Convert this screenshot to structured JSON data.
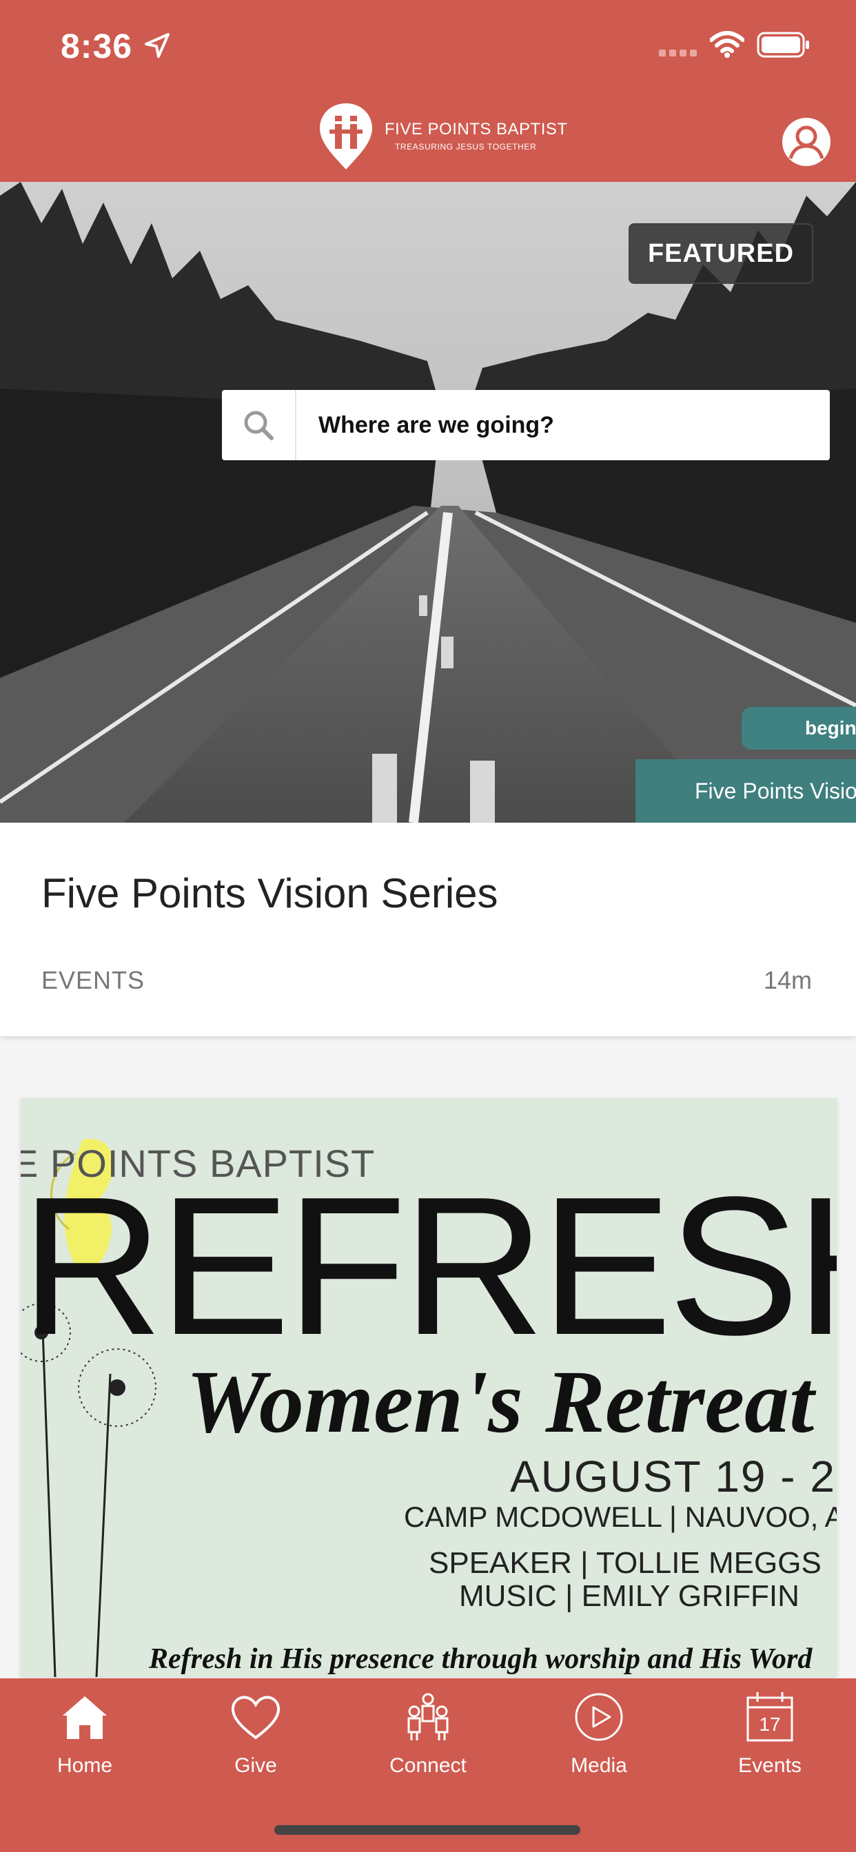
{
  "status_bar": {
    "time": "8:36"
  },
  "header": {
    "brand_name": "FIVE POINTS BAPTIST",
    "brand_tagline": "TREASURING JESUS TOGETHER"
  },
  "featured": {
    "badge": "FEATURED",
    "search_placeholder": "Where are we going?",
    "begin_pill": "begin",
    "strip_text": "Five Points Visio"
  },
  "card": {
    "title": "Five Points Vision Series",
    "category": "EVENTS",
    "age": "14m"
  },
  "retreat_card": {
    "church": "E POINTS BAPTIST",
    "headline": "REFRESH",
    "subheadline": "Women's Retreat",
    "date": "AUGUST 19 - 2",
    "location": "CAMP MCDOWELL  |  NAUVOO, AL",
    "speaker": "SPEAKER  | TOLLIE MEGGS",
    "music": "MUSIC    | EMILY GRIFFIN",
    "tagline": "Refresh in His presence through worship and His Word"
  },
  "tabs": [
    {
      "label": "Home",
      "icon": "home-icon"
    },
    {
      "label": "Give",
      "icon": "heart-icon"
    },
    {
      "label": "Connect",
      "icon": "people-icon"
    },
    {
      "label": "Media",
      "icon": "play-icon"
    },
    {
      "label": "Events",
      "icon": "calendar-icon",
      "badge": "17"
    }
  ],
  "colors": {
    "brand": "#cf5a4f",
    "teal": "#3f8080"
  }
}
